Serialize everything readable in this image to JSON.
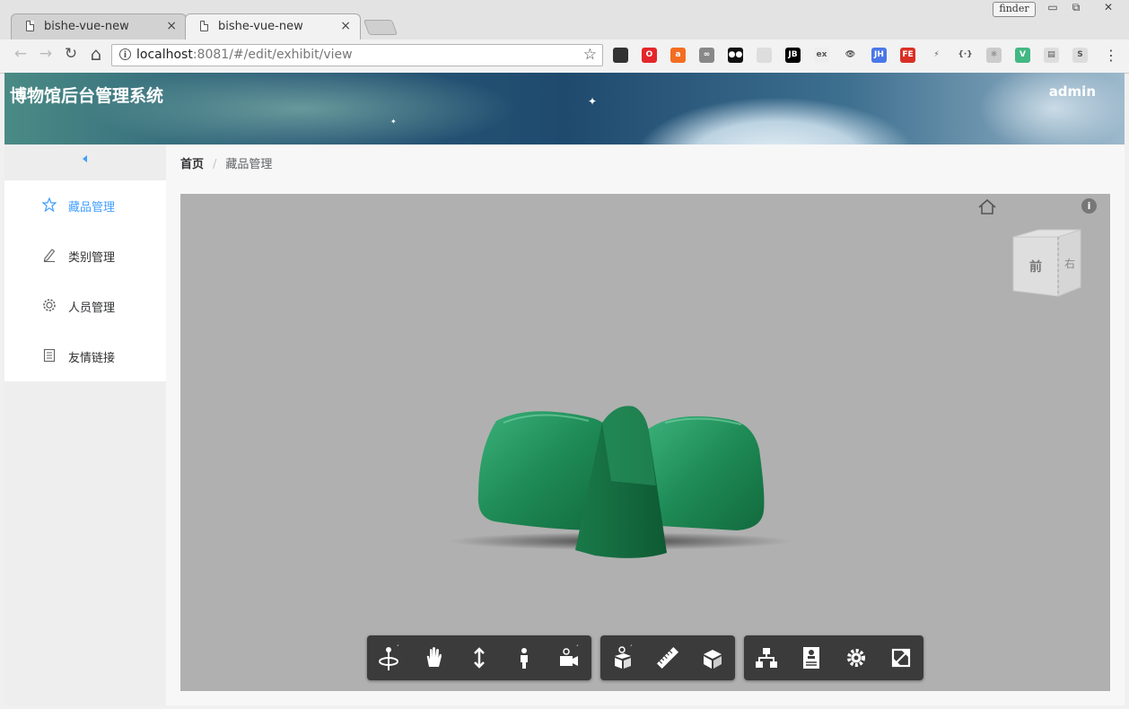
{
  "browser": {
    "tabs": [
      {
        "title": "bishe-vue-new",
        "close": "×",
        "active": false
      },
      {
        "title": "bishe-vue-new",
        "close": "×",
        "active": true
      }
    ],
    "finder_label": "finder",
    "window_controls": {
      "minimize": "▭",
      "restore": "⧉",
      "close": "✕"
    },
    "nav": {
      "back": "←",
      "forward": "→",
      "reload": "↻",
      "home": "⌂"
    },
    "address": {
      "host": "localhost",
      "rest": ":8081/#/edit/exhibit/view"
    },
    "bookmark_star": "☆",
    "extensions": [
      {
        "icon": "dragon-icon",
        "text": "",
        "color": "#333333"
      },
      {
        "icon": "opera-icon",
        "text": "O",
        "color": "#e3262a"
      },
      {
        "icon": "lang-icon",
        "text": "a",
        "color": "#f36d21"
      },
      {
        "icon": "link-icon",
        "text": "∞",
        "color": "#888888"
      },
      {
        "icon": "tampermonkey-icon",
        "text": "●●",
        "color": "#111111"
      },
      {
        "icon": "image-icon",
        "text": "",
        "color": "#dddddd"
      },
      {
        "icon": "jetbrains-icon",
        "text": "JB",
        "color": "#000000"
      },
      {
        "icon": "ex-icon",
        "text": "ex",
        "color": "#eeeeee"
      },
      {
        "icon": "eye-icon",
        "text": "👁",
        "color": "#f2f2f2"
      },
      {
        "icon": "jh-icon",
        "text": "JH",
        "color": "#4a77e8"
      },
      {
        "icon": "fe-icon",
        "text": "FE",
        "color": "#d93025"
      },
      {
        "icon": "bolt-icon",
        "text": "⚡",
        "color": "#f2f2f2"
      },
      {
        "icon": "json-icon",
        "text": "{·}",
        "color": "#f2f2f2"
      },
      {
        "icon": "react-icon",
        "text": "⚛",
        "color": "#cccccc"
      },
      {
        "icon": "vue-icon",
        "text": "V",
        "color": "#42b883"
      },
      {
        "icon": "layout-icon",
        "text": "▤",
        "color": "#dddddd"
      },
      {
        "icon": "s-icon",
        "text": "S",
        "color": "#dddddd"
      }
    ],
    "menu": "⋮"
  },
  "app": {
    "title": "博物馆后台管理系统",
    "user": "admin",
    "breadcrumb": {
      "home": "首页",
      "separator": "/",
      "current": "藏品管理"
    },
    "sidebar": [
      {
        "label": "藏品管理",
        "icon": "star-icon",
        "active": true
      },
      {
        "label": "类别管理",
        "icon": "edit-icon",
        "active": false
      },
      {
        "label": "人员管理",
        "icon": "gear-icon",
        "active": false
      },
      {
        "label": "友情链接",
        "icon": "document-icon",
        "active": false
      }
    ],
    "accent_color": "#409eff",
    "viewer": {
      "viewcube_front": "前",
      "viewcube_right": "右",
      "info_label": "i",
      "toolbar_groups": [
        [
          "orbit-icon",
          "pan-icon",
          "zoom-icon",
          "first-person-icon",
          "camera-icon"
        ],
        [
          "explode-icon",
          "measure-icon",
          "section-icon"
        ],
        [
          "model-browser-icon",
          "properties-icon",
          "settings-icon",
          "fullscreen-icon"
        ]
      ],
      "model_color": "#1e8a55"
    }
  }
}
